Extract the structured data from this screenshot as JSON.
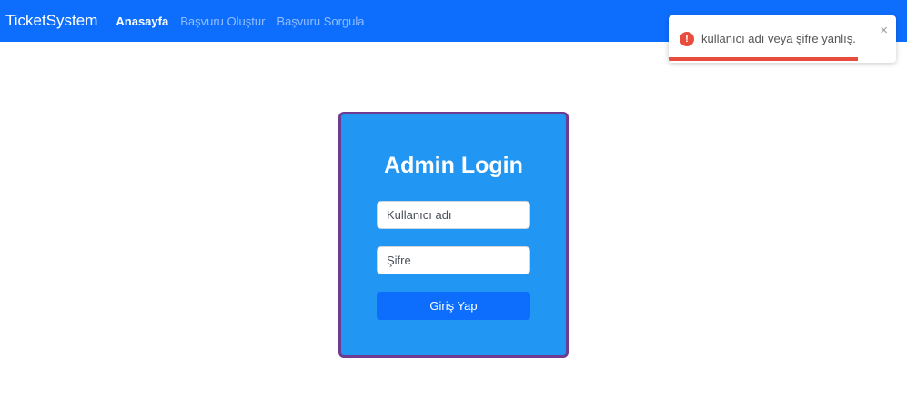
{
  "navbar": {
    "brand": "TicketSystem",
    "links": [
      {
        "label": "Anasayfa",
        "active": true
      },
      {
        "label": "Başvuru Oluştur",
        "active": false
      },
      {
        "label": "Başvuru Sorgula",
        "active": false
      }
    ]
  },
  "login": {
    "title": "Admin Login",
    "username_placeholder": "Kullanıcı adı",
    "password_placeholder": "Şifre",
    "submit_label": "Giriş Yap"
  },
  "toast": {
    "message": "kullanıcı adı veya şifre yanlış.",
    "icon": "error-icon",
    "close_symbol": "×",
    "progress_fraction": 0.83
  },
  "colors": {
    "navbar": "#0d6efd",
    "card": "#2196f3",
    "card_border": "#6f3b91",
    "button": "#0d6efd",
    "error": "#e74c3c"
  }
}
